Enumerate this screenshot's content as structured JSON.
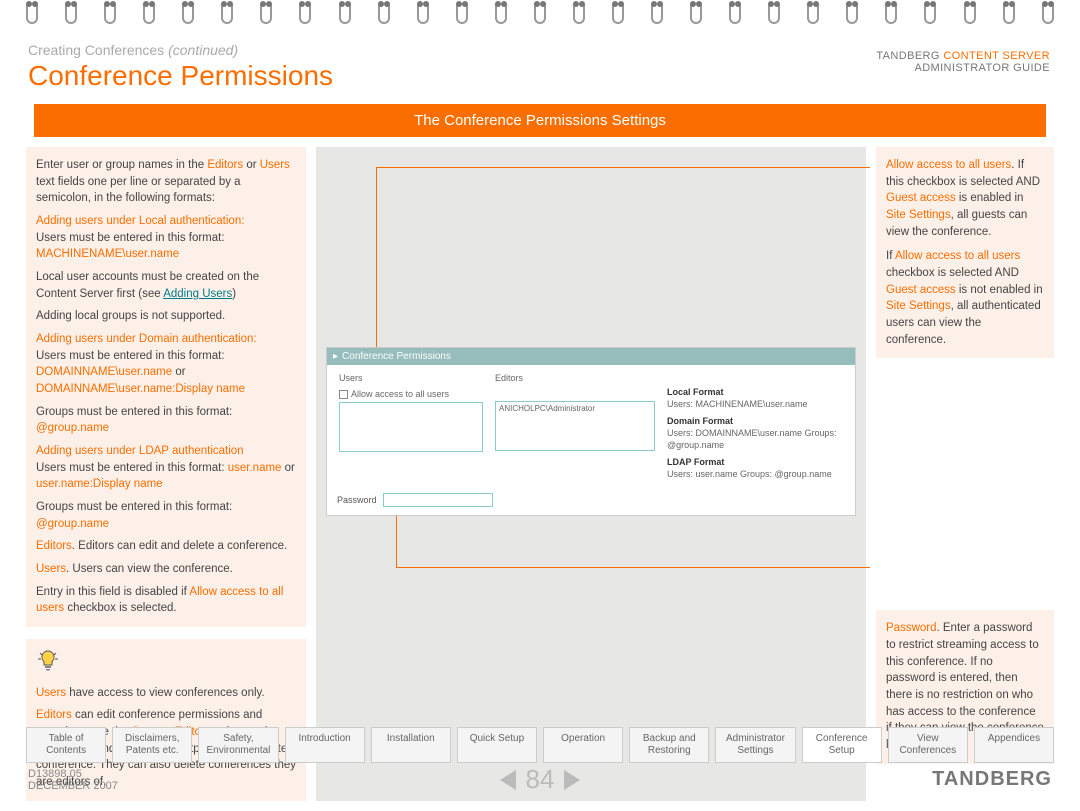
{
  "breadcrumb": {
    "main": "Creating Conferences ",
    "cont": "(continued)"
  },
  "title": "Conference Permissions",
  "hdr_right": {
    "line1_a": "TANDBERG ",
    "line1_b": "CONTENT SERVER",
    "line2": "ADMINISTRATOR GUIDE"
  },
  "banner": "The Conference Permissions Settings",
  "left1": {
    "p1a": "Enter user or group names in the ",
    "p1b": "Editors",
    "p1c": " or ",
    "p1d": "Users",
    "p1e": " text fields one per line or separated by a semicolon, in the following formats:",
    "h1": "Adding users under Local authentication:",
    "p2": "Users must be entered in this format:",
    "p2b": "MACHINENAME\\user.name",
    "p3a": "Local user accounts must be created on the Content Server first (see ",
    "p3b": "Adding Users",
    "p3c": ")",
    "p4": "Adding local groups is not supported.",
    "h2": "Adding users under Domain authentication:",
    "p5": "Users must be entered in this format:",
    "p5b": "DOMAINNAME\\user.name",
    "p5c": " or ",
    "p5d": "DOMAINNAME\\user.name:Display name",
    "p6a": "Groups must be entered in this format: ",
    "p6b": "@group.name",
    "h3": "Adding users under LDAP authentication",
    "p7a": "Users must be entered in this format: ",
    "p7b": "user.name",
    "p7c": " or ",
    "p7d": "user.name:Display name",
    "p8a": "Groups must be entered in this format: ",
    "p8b": "@group.name",
    "p9a": "Editors",
    "p9b": ". Editors can edit and delete a conference.",
    "p10a": "Users",
    "p10b": ". Users can view the conference.",
    "p11a": "Entry in this field is disabled if ",
    "p11b": "Allow access to all users",
    "p11c": " checkbox is selected."
  },
  "left2": {
    "l1a": "Users",
    "l1b": " have access to view conferences only.",
    "l2a": "Editors",
    "l2b": " can edit conference permissions and metadata, use the ",
    "l2c": "Content Editor",
    "l2d": " to change the conference and add further outputs to a completed conference. They can also delete conferences they are editors of."
  },
  "right1": {
    "r1a": "Allow access to all users",
    "r1b": ". If this checkbox is selected AND ",
    "r1c": "Guest access",
    "r1d": " is enabled in ",
    "r1e": "Site Settings",
    "r1f": ", all guests can view the conference.",
    "r2a": "If ",
    "r2b": "Allow access to all users",
    "r2c": " checkbox is selected AND ",
    "r2d": "Guest access",
    "r2e": " is not enabled in ",
    "r2f": "Site Settings",
    "r2g": ", all authenticated users can view the conference."
  },
  "right2": {
    "r1a": "Password",
    "r1b": ". Enter a password to restrict streaming access to this conference. If no password is entered, then there is no restriction on who has access to the conference if they can view the conference list."
  },
  "shot": {
    "header": "Conference Permissions",
    "users_label": "Users",
    "editors_label": "Editors",
    "allow_label": "Allow access to all users",
    "editor_value": "ANICHOLPC\\Administrator",
    "d_local_h": "Local Format",
    "d_local": "Users: MACHINENAME\\user.name",
    "d_domain_h": "Domain Format",
    "d_domain": "Users: DOMAINNAME\\user.name  Groups: @group.name",
    "d_ldap_h": "LDAP Format",
    "d_ldap": "Users: user.name  Groups: @group.name",
    "pwd_label": "Password"
  },
  "tabs": [
    "Table of Contents",
    "Disclaimers, Patents etc.",
    "Safety, Environmental",
    "Introduction",
    "Installation",
    "Quick Setup",
    "Operation",
    "Backup and Restoring",
    "Administrator Settings",
    "Conference Setup",
    "View Conferences",
    "Appendices"
  ],
  "footer": {
    "doc": "D13898.05",
    "date": "DECEMBER 2007",
    "page": "84",
    "brand": "TANDBERG"
  }
}
